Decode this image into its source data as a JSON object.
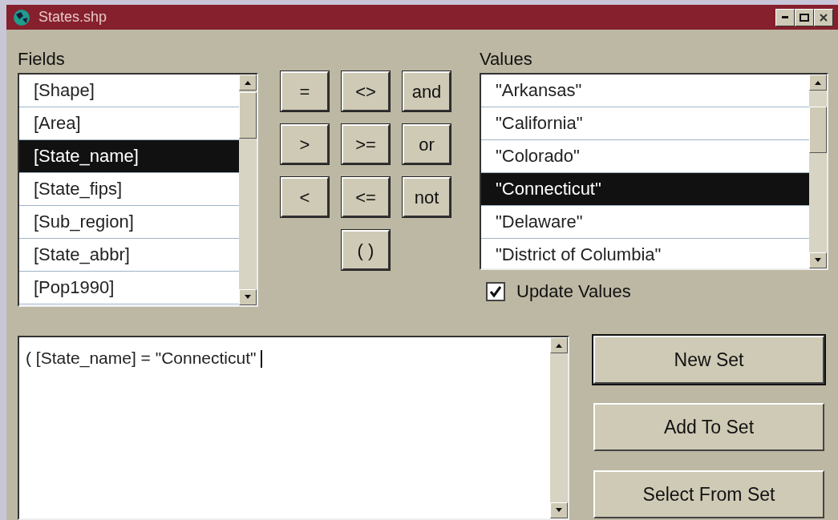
{
  "window": {
    "title": "States.shp"
  },
  "fields": {
    "label": "Fields",
    "items": [
      {
        "text": "[Shape]",
        "selected": false
      },
      {
        "text": "[Area]",
        "selected": false
      },
      {
        "text": "[State_name]",
        "selected": true
      },
      {
        "text": "[State_fips]",
        "selected": false
      },
      {
        "text": "[Sub_region]",
        "selected": false
      },
      {
        "text": "[State_abbr]",
        "selected": false
      },
      {
        "text": "[Pop1990]",
        "selected": false
      }
    ]
  },
  "operators": [
    "=",
    "<>",
    "and",
    ">",
    ">=",
    "or",
    "<",
    "<=",
    "not",
    "( )"
  ],
  "values": {
    "label": "Values",
    "items": [
      {
        "text": "\"Arkansas\"",
        "selected": false
      },
      {
        "text": "\"California\"",
        "selected": false
      },
      {
        "text": "\"Colorado\"",
        "selected": false
      },
      {
        "text": "\"Connecticut\"",
        "selected": true
      },
      {
        "text": "\"Delaware\"",
        "selected": false
      },
      {
        "text": "\"District of Columbia\"",
        "selected": false
      }
    ]
  },
  "update_values": {
    "label": "Update Values",
    "checked": true
  },
  "query": "( [State_name] = \"Connecticut\"",
  "buttons": [
    {
      "label": "New Set",
      "default": true
    },
    {
      "label": "Add To Set",
      "default": false
    },
    {
      "label": "Select From Set",
      "default": false
    }
  ]
}
